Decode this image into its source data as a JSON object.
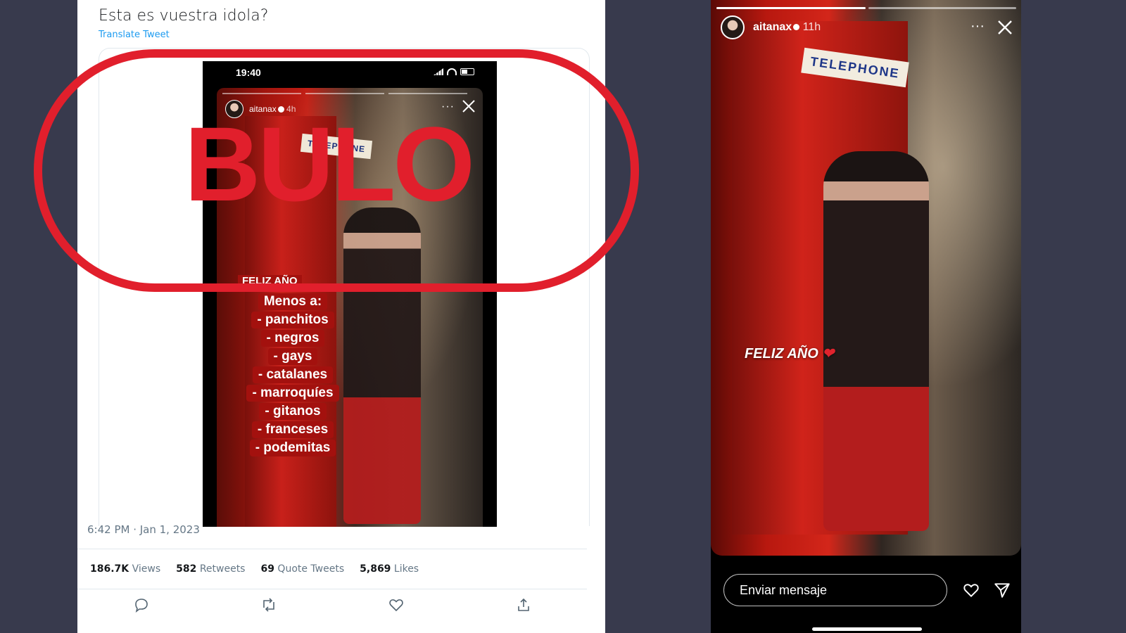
{
  "tweet": {
    "text": "Esta es vuestra idola?",
    "translate_label": "Translate Tweet",
    "timestamp": "6:42 PM · Jan 1, 2023",
    "stats": [
      {
        "value": "186.7K",
        "label": "Views"
      },
      {
        "value": "582",
        "label": "Retweets"
      },
      {
        "value": "69",
        "label": "Quote Tweets"
      },
      {
        "value": "5,869",
        "label": "Likes"
      }
    ],
    "actions": [
      "reply-icon",
      "retweet-icon",
      "like-icon",
      "share-icon"
    ]
  },
  "embedded_screenshot": {
    "phone_time": "19:40",
    "username": "aitanax",
    "time_ago": "4h",
    "booth_sign": "TELEPHONE",
    "caption_title": "FELIZ AÑO",
    "caption_lines": [
      "Menos a:",
      "- panchitos",
      "- negros",
      "- gays",
      "- catalanes",
      "- marroquíes",
      "- gitanos",
      "- franceses",
      "- podemitas"
    ]
  },
  "stamp": {
    "text": "BULO",
    "color": "#e11f2c"
  },
  "story": {
    "username": "aitanax",
    "time_ago": "11h",
    "menu": "···",
    "booth_sign": "TELEPHONE",
    "caption": "FELIZ AÑO",
    "message_placeholder": "Enviar mensaje"
  },
  "colors": {
    "background": "#383a4d",
    "twitter_link": "#1d9bf0",
    "booth_red": "#c8201a"
  }
}
